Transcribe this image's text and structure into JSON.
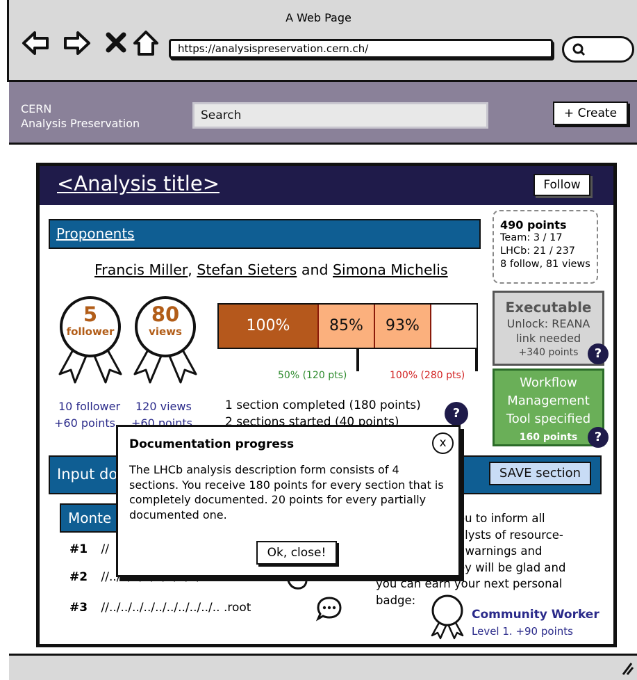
{
  "window": {
    "title": "A Web Page",
    "url": "https://analysispreservation.cern.ch/"
  },
  "app": {
    "brand_line1": "CERN",
    "brand_line2": "Analysis Preservation",
    "search_value": "Search",
    "create_label": "+ Create"
  },
  "analysis": {
    "title": "<Analysis title>",
    "follow_label": "Follow",
    "proponents_label": "Proponents",
    "proponents": [
      "Francis Miller",
      "Stefan Sieters",
      "Simona Michelis"
    ],
    "name_sep1": ",",
    "name_sep2": "and",
    "points": {
      "total": "490 points",
      "team": "Team: 3 / 17",
      "lhcb": "LHCb: 21 / 237",
      "follow_views": "8 follow, 81 views"
    }
  },
  "badges": [
    {
      "number": "5",
      "label": "follower",
      "caption1": "10 follower",
      "caption2": "+60 points"
    },
    {
      "number": "80",
      "label": "views",
      "caption1": "120 views",
      "caption2": "+60 points"
    }
  ],
  "progress": {
    "segments": [
      {
        "label": "100%",
        "value": 1.0,
        "color": "#b5581c",
        "text_color": "#ffffff"
      },
      {
        "label": "85%",
        "value": 0.85,
        "color": "#fbb07d",
        "text_color": "#111111"
      },
      {
        "label": "93%",
        "value": 0.93,
        "color": "#fbb07d",
        "text_color": "#111111"
      }
    ],
    "marker_50": "50% (120 pts)",
    "marker_100": "100% (280 pts)",
    "summary1": "1 section completed (180 points)",
    "summary2": "2 sections started (40 points)",
    "help": "?"
  },
  "executable": {
    "title": "Executable",
    "line1": "Unlock: REANA",
    "line2": "link needed",
    "points": "+340 points",
    "help": "?"
  },
  "workflow": {
    "line1": "Workflow",
    "line2": "Management",
    "line3": "Tool specified",
    "points": "160 points",
    "help": "?"
  },
  "input_section": {
    "title": "Input do",
    "save_label": "SAVE section",
    "monte_label": "Monte"
  },
  "files": [
    {
      "index": "#1",
      "path": "//"
    },
    {
      "index": "#2",
      "path": "//../../../../../../../../.. .root"
    },
    {
      "index": "#3",
      "path": "//../../../../../../../../../.. .root"
    }
  ],
  "community": {
    "text_lines": [
      "ou to inform all",
      "alysts of resource-",
      ", warnings and",
      "ey will be glad and",
      "you can earn your next personal",
      "badge:"
    ],
    "badge_title": "Community Worker",
    "badge_level": "Level 1. +90 points"
  },
  "dialog": {
    "title": "Documentation progress",
    "close_glyph": "x",
    "body": "The LHCb analysis description form consists of 4 sections. You receive 180 points for every section that is completely documented. 20 points for every partially documented one.",
    "ok_label": "Ok, close!"
  },
  "colors": {
    "header_dark": "#1f1b4a",
    "blue": "#0f5e93",
    "appbar": "#8a8199",
    "orange": "#b5581c",
    "green": "#6aaf58"
  }
}
